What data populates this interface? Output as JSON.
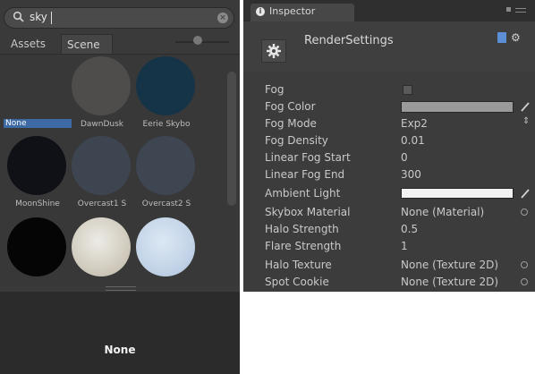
{
  "picker": {
    "search_query": "sky",
    "tabs": [
      "Assets",
      "Scene"
    ],
    "items": [
      {
        "label": "None",
        "color": "#383838",
        "selected": true
      },
      {
        "label": "DawnDusk",
        "color": "#4f4d4c",
        "selected": false
      },
      {
        "label": "Eerie Skybo",
        "color": "#163447",
        "selected": false
      },
      {
        "label": "MoonShine",
        "color": "#0f1116",
        "selected": false
      },
      {
        "label": "Overcast1 S",
        "color": "#3d4650",
        "selected": false
      },
      {
        "label": "Overcast2 S",
        "color": "#3e4652",
        "selected": false
      },
      {
        "label": "",
        "color": "#050505",
        "selected": false
      },
      {
        "label": "",
        "color": "#d8d3c6",
        "selected": false
      },
      {
        "label": "",
        "color": "#c6d6e8",
        "selected": false
      }
    ],
    "preview_label": "None"
  },
  "inspector": {
    "tab_title": "Inspector",
    "component_title": "RenderSettings",
    "properties": [
      {
        "label": "Fog",
        "kind": "checkbox",
        "value": ""
      },
      {
        "label": "Fog Color",
        "kind": "color",
        "value": ""
      },
      {
        "label": "Fog Mode",
        "kind": "enum",
        "value": "Exp2"
      },
      {
        "label": "Fog Density",
        "kind": "text",
        "value": "0.01"
      },
      {
        "label": "Linear Fog Start",
        "kind": "text",
        "value": "0"
      },
      {
        "label": "Linear Fog End",
        "kind": "text",
        "value": "300"
      },
      {
        "label": "Ambient Light",
        "kind": "color-white",
        "value": ""
      },
      {
        "label": "Skybox Material",
        "kind": "object",
        "value": "None (Material)"
      },
      {
        "label": "Halo Strength",
        "kind": "text",
        "value": "0.5"
      },
      {
        "label": "Flare Strength",
        "kind": "text",
        "value": "1"
      },
      {
        "label": "Halo Texture",
        "kind": "object",
        "value": "None (Texture 2D)"
      },
      {
        "label": "Spot Cookie",
        "kind": "object",
        "value": "None (Texture 2D)"
      }
    ]
  },
  "colors": {
    "selection": "#3d6aa5",
    "panel_bg": "#3c3c3c"
  }
}
